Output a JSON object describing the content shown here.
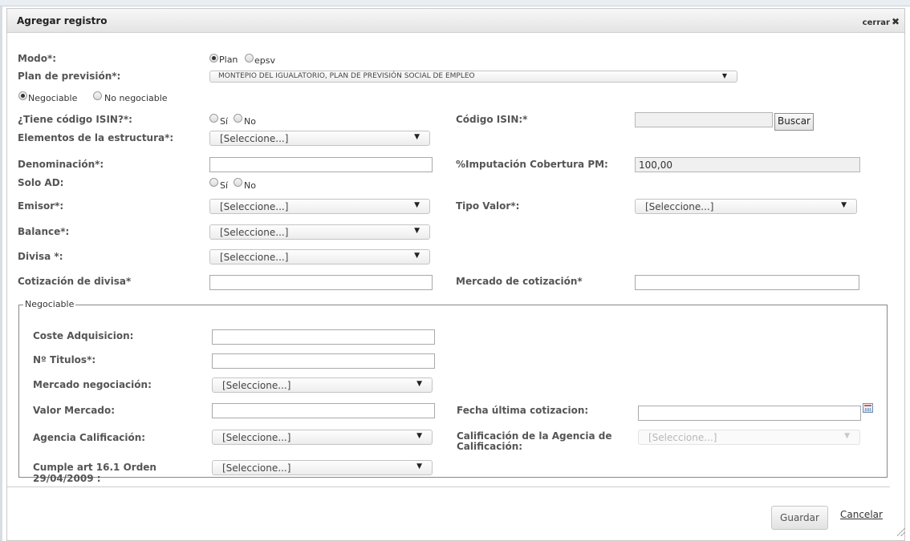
{
  "dialog": {
    "title": "Agregar registro",
    "close_label": "cerrar",
    "close_glyph": "✖"
  },
  "form": {
    "modo": {
      "label": "Modo*:",
      "options": [
        "Plan",
        "epsv"
      ],
      "selected": "Plan"
    },
    "plan": {
      "label": "Plan de previsión*:",
      "value": "MONTEPIO DEL IGUALATORIO, PLAN DE PREVISIÓN SOCIAL DE EMPLEO"
    },
    "negociable": {
      "options": [
        "Negociable",
        "No negociable"
      ],
      "selected": "Negociable"
    },
    "tiene_isin": {
      "label": "¿Tiene código ISIN?*:",
      "options": [
        "Sí",
        "No"
      ],
      "selected": ""
    },
    "codigo_isin": {
      "label": "Código ISIN:*",
      "value": "",
      "button": "Buscar"
    },
    "elementos": {
      "label": "Elementos de la estructura*:",
      "value": "[Seleccione...]"
    },
    "denominacion": {
      "label": "Denominación*:",
      "value": ""
    },
    "imputacion": {
      "label": "%Imputación Cobertura PM:",
      "value": "100,00"
    },
    "solo_ad": {
      "label": "Solo AD:",
      "options": [
        "Sí",
        "No"
      ],
      "selected": ""
    },
    "emisor": {
      "label": "Emisor*:",
      "value": "[Seleccione...]"
    },
    "tipo_valor": {
      "label": "Tipo Valor*:",
      "value": "[Seleccione...]"
    },
    "balance": {
      "label": "Balance*:",
      "value": "[Seleccione...]"
    },
    "divisa": {
      "label": "Divisa *:",
      "value": "[Seleccione...]"
    },
    "cotizacion_divisa": {
      "label": "Cotización de divisa*",
      "value": ""
    },
    "mercado_cotizacion": {
      "label": "Mercado de cotización*",
      "value": ""
    }
  },
  "negociable_group": {
    "legend": "Negociable",
    "coste": {
      "label": "Coste Adquisicion:",
      "value": ""
    },
    "titulos": {
      "label": "Nº Titulos*:",
      "value": ""
    },
    "mercado_negociacion": {
      "label": "Mercado negociación:",
      "value": "[Seleccione...]"
    },
    "valor_mercado": {
      "label": "Valor Mercado:",
      "value": ""
    },
    "fecha_cotizacion": {
      "label": "Fecha última cotizacion:",
      "value": ""
    },
    "agencia": {
      "label": "Agencia Calificación:",
      "value": "[Seleccione...]"
    },
    "calificacion_agencia": {
      "label_line1": "Calificación de la Agencia de",
      "label_line2": "Calificación:",
      "value": "[Seleccione...]"
    },
    "cumple": {
      "label_line1": "Cumple art 16.1 Orden",
      "label_line2": "29/04/2009 :",
      "value": "[Seleccione...]"
    }
  },
  "footer": {
    "save": "Guardar",
    "cancel": "Cancelar"
  },
  "icons": {
    "dropdown": "▼",
    "calendar": "calendar-icon"
  }
}
